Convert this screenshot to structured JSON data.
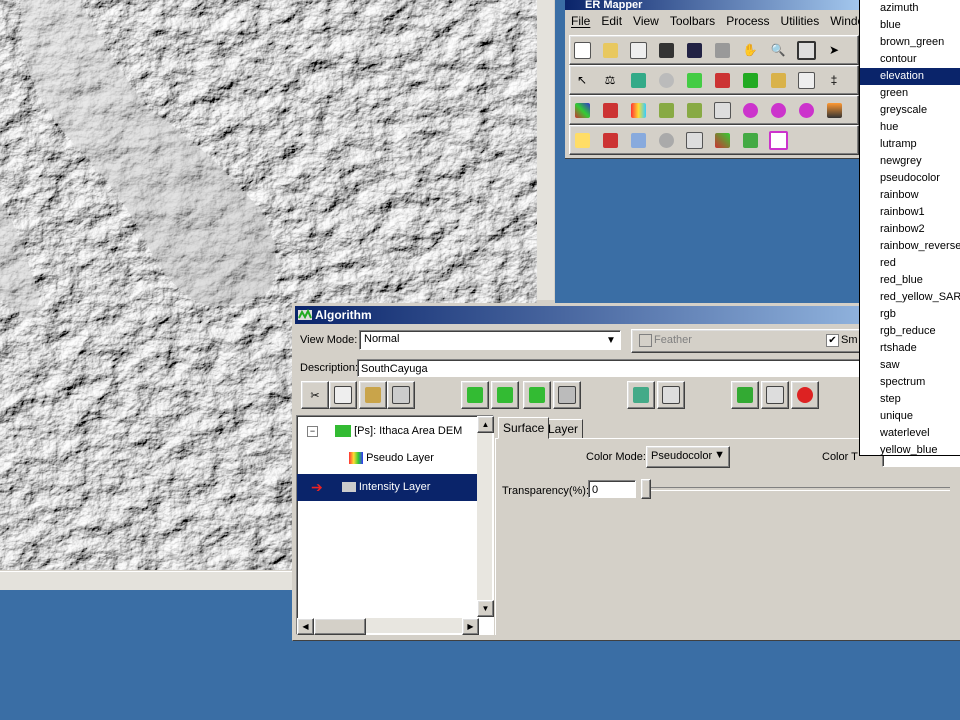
{
  "ermapper": {
    "title": "ER Mapper",
    "menu": [
      "File",
      "Edit",
      "View",
      "Toolbars",
      "Process",
      "Utilities",
      "Windows"
    ]
  },
  "algorithm": {
    "title": "Algorithm",
    "view_mode_label": "View Mode:",
    "view_mode_value": "Normal",
    "feather_label": "Feather",
    "smooth_label": "Sm",
    "smooth_checked": true,
    "description_label": "Description:",
    "description_value": "SouthCayuga",
    "tree": {
      "root": "[Ps]: Ithaca Area DEM",
      "items": [
        "Pseudo Layer",
        "Intensity Layer"
      ],
      "selected_index": 1
    },
    "tabs": [
      "Surface",
      "Layer"
    ],
    "color_mode_label": "Color Mode:",
    "color_mode_value": "Pseudocolor",
    "color_table_label": "Color T",
    "transparency_label": "Transparency(%):",
    "transparency_value": "0"
  },
  "lut_options": [
    "azimuth",
    "blue",
    "brown_green",
    "contour",
    "elevation",
    "green",
    "greyscale",
    "hue",
    "lutramp",
    "newgrey",
    "pseudocolor",
    "rainbow",
    "rainbow1",
    "rainbow2",
    "rainbow_reverse",
    "red",
    "red_blue",
    "red_yellow_SAR",
    "rgb",
    "rgb_reduce",
    "rtshade",
    "saw",
    "spectrum",
    "step",
    "unique",
    "waterlevel",
    "yellow_blue"
  ],
  "lut_selected": "elevation",
  "colors": {
    "desktop": "#3a6ea5",
    "title_active": "#0a246a",
    "selection": "#0a246a"
  }
}
